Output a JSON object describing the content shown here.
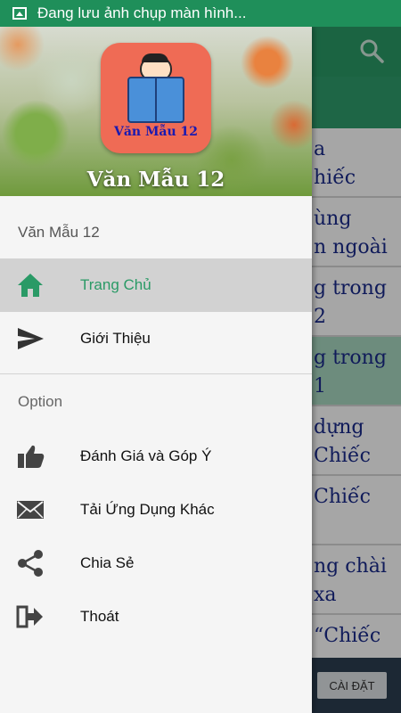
{
  "status_bar": {
    "text": "Đang lưu ảnh chụp màn hình..."
  },
  "background_app": {
    "list_fragments": [
      [
        "a",
        "hiếc"
      ],
      [
        "ùng",
        "n ngoài"
      ],
      [
        "g trong",
        "2"
      ],
      [
        "g trong",
        "1"
      ],
      [
        "dựng",
        "Chiếc"
      ],
      [
        "Chiếc",
        ""
      ],
      [
        "ng chài",
        " xa"
      ],
      [
        "“Chiếc",
        ""
      ]
    ],
    "install_button": "CÀI ĐẶT"
  },
  "drawer": {
    "header": {
      "logo_text": "Văn Mẫu 12",
      "title": "Văn Mẫu 12"
    },
    "subheader": "Văn Mẫu 12",
    "primary_items": [
      {
        "label": "Trang Chủ",
        "icon": "home-icon"
      },
      {
        "label": "Giới Thiệu",
        "icon": "send-icon"
      }
    ],
    "section_title": "Option",
    "option_items": [
      {
        "label": "Đánh Giá và Góp Ý",
        "icon": "thumbs-up-icon"
      },
      {
        "label": "Tải Ứng Dụng Khác",
        "icon": "mail-icon"
      },
      {
        "label": "Chia Sẻ",
        "icon": "share-icon"
      },
      {
        "label": "Thoát",
        "icon": "exit-icon"
      }
    ]
  },
  "colors": {
    "accent": "#2a9a66",
    "status_bar": "#1f8f5a",
    "logo_bg": "#ef6b55"
  }
}
